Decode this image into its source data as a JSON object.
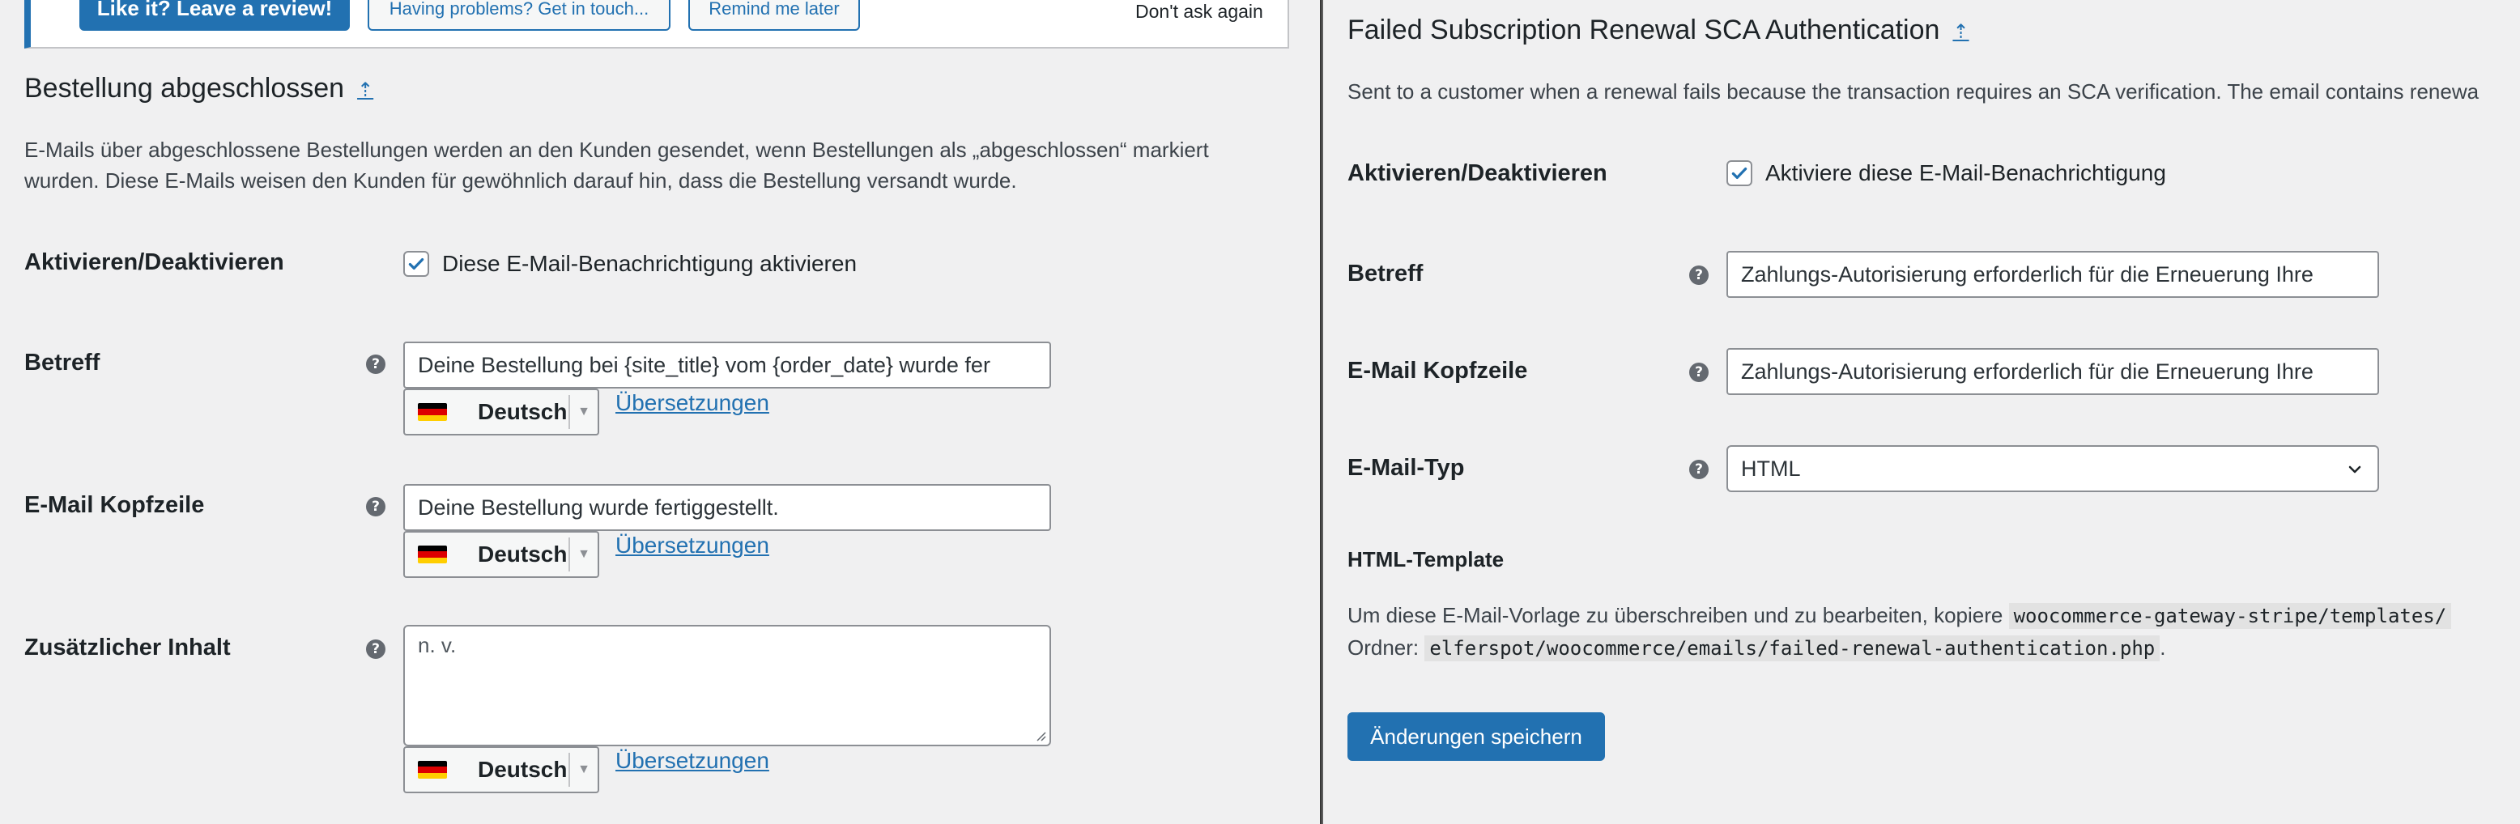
{
  "left": {
    "notice": {
      "review_button": "Like it? Leave a review!",
      "problems_button": "Having problems? Get in touch...",
      "remind_button": "Remind me later",
      "dismiss_link": "Don't ask again"
    },
    "section_title": "Bestellung abgeschlossen",
    "up_link": "⇡",
    "description": "E-Mails über abgeschlossene Bestellungen werden an den Kunden gesendet, wenn Bestellungen als „abgeschlossen“ markiert wurden. Diese E-Mails weisen den Kunden für gewöhnlich darauf hin, dass die Bestellung versandt wurde.",
    "enable": {
      "label": "Aktivieren/Deaktivieren",
      "checkbox_label": "Diese E-Mail-Benachrichtigung aktivieren",
      "checked": true
    },
    "subject": {
      "label": "Betreff",
      "value": "Deine Bestellung bei {site_title} vom {order_date} wurde fer",
      "language": "Deutsch",
      "translations_link": "Übersetzungen"
    },
    "heading": {
      "label": "E-Mail Kopfzeile",
      "value": "Deine Bestellung wurde fertiggestellt.",
      "language": "Deutsch",
      "translations_link": "Übersetzungen"
    },
    "additional": {
      "label": "Zusätzlicher Inhalt",
      "value": "n. v.",
      "language": "Deutsch",
      "translations_link": "Übersetzungen"
    }
  },
  "right": {
    "section_title": "Failed Subscription Renewal SCA Authentication",
    "up_link": "⇡",
    "description": "Sent to a customer when a renewal fails because the transaction requires an SCA verification. The email contains renewa",
    "enable": {
      "label": "Aktivieren/Deaktivieren",
      "checkbox_label": "Aktiviere diese E-Mail-Benachrichtigung",
      "checked": true
    },
    "subject": {
      "label": "Betreff",
      "value": "Zahlungs-Autorisierung erforderlich für die Erneuerung Ihre"
    },
    "heading": {
      "label": "E-Mail Kopfzeile",
      "value": "Zahlungs-Autorisierung erforderlich für die Erneuerung Ihre"
    },
    "email_type": {
      "label": "E-Mail-Typ",
      "selected": "HTML"
    },
    "template": {
      "heading": "HTML-Template",
      "line1_prefix": "Um diese E-Mail-Vorlage zu überschreiben und zu bearbeiten, kopiere",
      "line1_code": "woocommerce-gateway-stripe/templates/",
      "line2_prefix": "Ordner:",
      "line2_code": "elferspot/woocommerce/emails/failed-renewal-authentication.php",
      "line2_suffix": "."
    },
    "save_button": "Änderungen speichern"
  },
  "colors": {
    "accent": "#2271b1",
    "background": "#f0f0f1",
    "text": "#1d2327"
  },
  "icons": {
    "help": "help-circle-icon",
    "checkmark": "checkmark-icon",
    "flag": "german-flag-icon",
    "dropdown": "chevron-down-icon"
  }
}
